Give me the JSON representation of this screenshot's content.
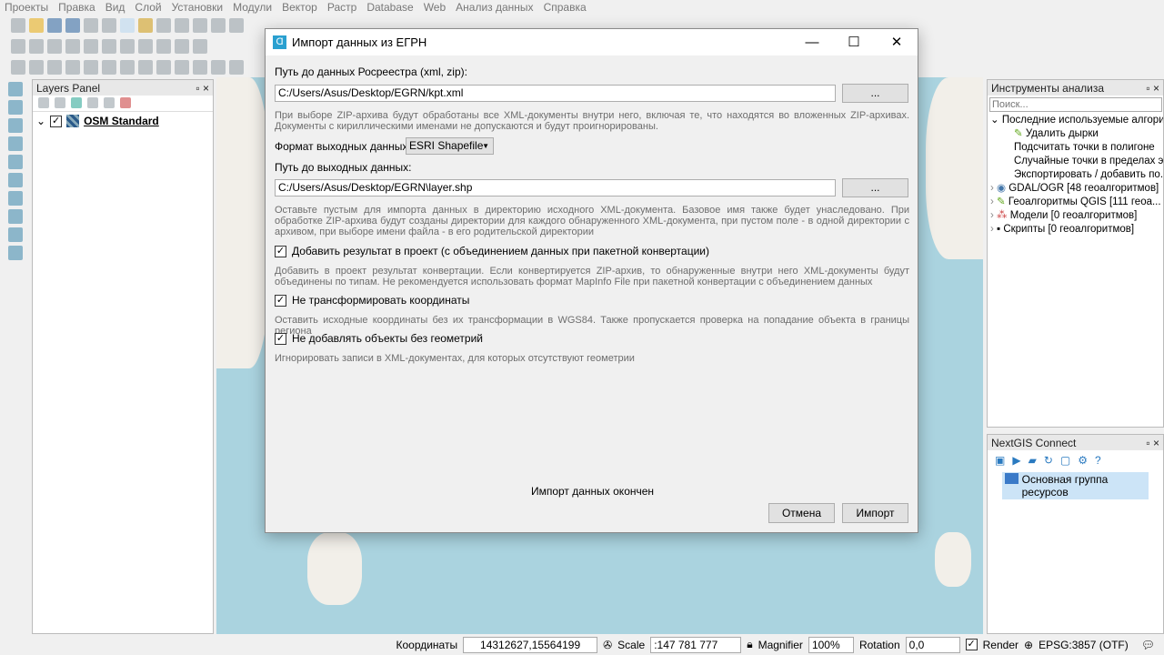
{
  "menu": [
    "Проекты",
    "Правка",
    "Вид",
    "Слой",
    "Установки",
    "Модули",
    "Вектор",
    "Растр",
    "Database",
    "Web",
    "Анализ данных",
    "Справка"
  ],
  "layers_panel": {
    "title": "Layers Panel",
    "layer": "OSM Standard"
  },
  "analysis_panel": {
    "title": "Инструменты анализа",
    "search_placeholder": "Поиск...",
    "recent": "Последние используемые алгори...",
    "recent_items": [
      "Удалить дырки",
      "Подсчитать точки в полигоне",
      "Случайные точки в пределах э...",
      "Экспортировать / добавить по..."
    ],
    "groups": [
      "GDAL/OGR [48 геоалгоритмов]",
      "Геоалгоритмы QGIS [111 геоа...",
      "Модели [0 геоалгоритмов]",
      "Скрипты [0 геоалгоритмов]"
    ]
  },
  "nextgis_panel": {
    "title": "NextGIS Connect",
    "item": "Основная группа ресурсов"
  },
  "status": {
    "coords_label": "Координаты",
    "coords": "14312627,15564199",
    "scale_label": "Scale",
    "scale": ":147 781 777",
    "magnifier_label": "Magnifier",
    "magnifier": "100%",
    "rotation_label": "Rotation",
    "rotation": "0,0",
    "render": "Render",
    "crs": "EPSG:3857 (OTF)"
  },
  "dialog": {
    "title": "Импорт данных из ЕГРН",
    "input_label": "Путь до данных Росреестра (xml, zip):",
    "input_path": "C:/Users/Asus/Desktop/EGRN/kpt.xml",
    "browse": "...",
    "input_hint": "При выборе ZIP-архива будут обработаны все XML-документы внутри него, включая те, что находятся во вложенных ZIP-архивах. Документы с кириллическими именами не допускаются и будут проигнорированы.",
    "format_label": "Формат выходных данных:",
    "format": "ESRI Shapefile",
    "output_label": "Путь до выходных данных:",
    "output_path": "C:/Users/Asus/Desktop/EGRN\\layer.shp",
    "output_hint": "Оставьте пустым для импорта данных в директорию исходного XML-документа. Базовое имя также будет унаследовано. При обработке ZIP-архива будут созданы директории для каждого обнаруженного XML-документа, при пустом поле - в одной директории с архивом, при выборе имени файла - в его родительской директории",
    "cb1": "Добавить результат в проект (с объединением данных при пакетной конвертации)",
    "cb1_hint": "Добавить в проект результат конвертации. Если конвертируется ZIP-архив, то обнаруженные внутри него XML-документы будут объединены по типам. Не рекомендуется использовать формат MapInfo File при пакетной конвертации с объединением данных",
    "cb2": "Не трансформировать координаты",
    "cb2_hint": "Оставить исходные координаты без их трансформации в WGS84. Также пропускается проверка на попадание объекта в границы региона",
    "cb3": "Не добавлять объекты без геометрий",
    "cb3_hint": "Игнорировать записи в XML-документах, для которых отсутствуют геометрии",
    "checked": [
      true,
      true,
      true
    ],
    "status": "Импорт данных окончен",
    "cancel": "Отмена",
    "import": "Импорт"
  }
}
